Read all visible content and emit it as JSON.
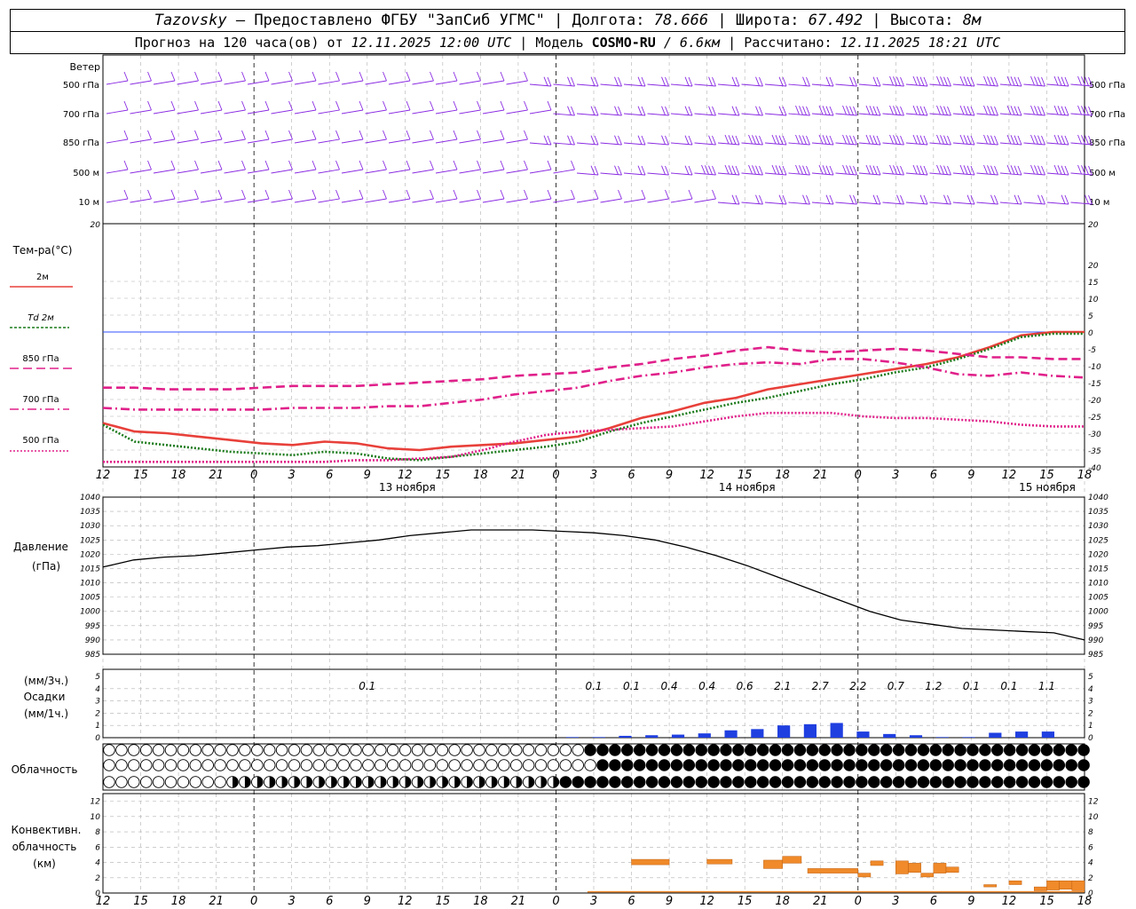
{
  "header": {
    "station": "Tazovsky",
    "provider": "— Предоставлено ФГБУ \"ЗапСиб УГМС\"",
    "lon_label": "Долгота:",
    "lon_value": "78.666",
    "lat_label": "Широта:",
    "lat_value": "67.492",
    "alt_label": "Высота:",
    "alt_value": "8м",
    "forecast_label": "Прогноз на 120 часа(ов) от",
    "forecast_start": "12.11.2025 12:00 UTC",
    "model_label": "Модель",
    "model_name": "COSMO-RU",
    "model_res": "/ 6.6км",
    "calc_label": "Рассчитано:",
    "calc_time": "12.11.2025 18:21 UTC"
  },
  "colors": {
    "wind": "#8a2be2",
    "t2m": "#e8403a",
    "td2m": "#1a7a1a",
    "t850": "#e0208a",
    "t700": "#e0208a",
    "t500": "#e0208a",
    "pressure": "#000000",
    "precip": "#1f3fe0",
    "convective": "#f08a2a",
    "zero_line": "#3050ff",
    "grid": "#b0b0b0"
  },
  "time_axis": {
    "hour_labels": [
      "12",
      "15",
      "18",
      "21",
      "0",
      "3",
      "6",
      "9",
      "12",
      "15",
      "18",
      "21",
      "0",
      "3",
      "6",
      "9",
      "12",
      "15",
      "18",
      "21",
      "0",
      "3",
      "6",
      "9",
      "12",
      "15",
      "18"
    ],
    "day_labels": [
      "13 ноября",
      "14 ноября",
      "15 ноября"
    ]
  },
  "wind_panel": {
    "title": "Ветер",
    "levels": [
      "500 гПа",
      "700 гПа",
      "850 гПа",
      "500 м",
      "10  м"
    ],
    "speed_class": [
      [
        1,
        1,
        1,
        1,
        1,
        1,
        1,
        1,
        1,
        1,
        1,
        1,
        1,
        1,
        1,
        1,
        1,
        1,
        2,
        2,
        2,
        2,
        2,
        2,
        2,
        2,
        2,
        2,
        2,
        2,
        2,
        2,
        2,
        3,
        3,
        3,
        3,
        3,
        3,
        3,
        3,
        3
      ],
      [
        1,
        1,
        1,
        1,
        1,
        1,
        1,
        1,
        1,
        1,
        1,
        1,
        1,
        1,
        1,
        1,
        1,
        1,
        1,
        2,
        2,
        2,
        2,
        2,
        2,
        2,
        2,
        2,
        2,
        3,
        3,
        3,
        3,
        3,
        3,
        3,
        3,
        3,
        3,
        3,
        3,
        3
      ],
      [
        1,
        1,
        1,
        1,
        1,
        1,
        1,
        1,
        1,
        1,
        1,
        1,
        1,
        1,
        1,
        1,
        1,
        1,
        2,
        2,
        2,
        2,
        2,
        2,
        2,
        2,
        3,
        3,
        3,
        3,
        3,
        3,
        3,
        3,
        3,
        3,
        3,
        3,
        3,
        3,
        3,
        3
      ],
      [
        1,
        1,
        1,
        1,
        1,
        1,
        1,
        1,
        1,
        1,
        1,
        1,
        1,
        1,
        1,
        1,
        1,
        1,
        1,
        1,
        2,
        2,
        2,
        2,
        2,
        3,
        3,
        3,
        3,
        3,
        3,
        3,
        3,
        3,
        3,
        3,
        3,
        3,
        3,
        3,
        3,
        3
      ],
      [
        1,
        1,
        1,
        1,
        1,
        1,
        1,
        1,
        1,
        1,
        1,
        1,
        1,
        1,
        1,
        1,
        1,
        1,
        1,
        1,
        1,
        1,
        1,
        1,
        1,
        1,
        2,
        2,
        2,
        2,
        2,
        2,
        2,
        2,
        2,
        2,
        2,
        2,
        2,
        2,
        2,
        2
      ]
    ]
  },
  "temp_panel": {
    "title": "Тем-ра(°C)",
    "legend": [
      "2м",
      "Td  2м",
      "850 гПа",
      "700 гПа",
      "500 гПа"
    ],
    "ticks": [
      "20",
      "15",
      "10",
      "5",
      "0",
      "-5",
      "-10",
      "-15",
      "-20",
      "-25",
      "-30",
      "-35",
      "-40"
    ]
  },
  "pressure_panel": {
    "title": "Давление",
    "unit": "(гПа)",
    "ticks": [
      "1040",
      "1035",
      "1030",
      "1025",
      "1020",
      "1015",
      "1010",
      "1005",
      "1000",
      "995",
      "990",
      "985"
    ]
  },
  "precip_panel": {
    "unit_top": "(мм/3ч.)",
    "title": "Осадки",
    "unit_bottom": "(мм/1ч.)",
    "ticks": [
      "5",
      "4",
      "3",
      "2",
      "1",
      "0"
    ],
    "totals": [
      {
        "hour": 21,
        "label": "0.1"
      },
      {
        "hour": 39,
        "label": "0.1"
      },
      {
        "hour": 42,
        "label": "0.1"
      },
      {
        "hour": 45,
        "label": "0.4"
      },
      {
        "hour": 48,
        "label": "0.4"
      },
      {
        "hour": 51,
        "label": "0.6"
      },
      {
        "hour": 54,
        "label": "2.1"
      },
      {
        "hour": 57,
        "label": "2.7"
      },
      {
        "hour": 60,
        "label": "2.2"
      },
      {
        "hour": 63,
        "label": "0.7"
      },
      {
        "hour": 66,
        "label": "1.2"
      },
      {
        "hour": 69,
        "label": "0.1"
      },
      {
        "hour": 72,
        "label": "0.1"
      },
      {
        "hour": 75,
        "label": "1.1"
      }
    ]
  },
  "cloud_panel": {
    "title": "Облачность"
  },
  "conv_panel": {
    "title_1": "Конвективн.",
    "title_2": "облачность",
    "unit": "(км)",
    "ticks": [
      "12",
      "10",
      "8",
      "6",
      "4",
      "2",
      "0"
    ]
  },
  "chart_data": [
    {
      "type": "line",
      "title": "Тем-ра(°C)",
      "x_unit": "hours from 12.11.2025 12:00 UTC",
      "ylim": [
        -40,
        20
      ],
      "grid": true,
      "x": [
        0,
        3,
        6,
        9,
        12,
        15,
        18,
        21,
        24,
        27,
        30,
        33,
        36,
        39,
        42,
        45,
        48,
        51,
        54,
        57,
        60,
        63,
        66,
        69,
        72,
        75,
        78
      ],
      "series": [
        {
          "name": "2м",
          "style": "solid",
          "values": [
            -27,
            -29.5,
            -30,
            -31,
            -32,
            -33,
            -33.5,
            -32.5,
            -33,
            -34.5,
            -35,
            -34,
            -33.5,
            -33,
            -32,
            -31,
            -28.5,
            -25.5,
            -23.5,
            -21,
            -19.5,
            -17,
            -15.5,
            -14,
            -12.5,
            -11,
            -9.5,
            -7.5,
            -4.5,
            -1,
            0,
            0
          ]
        },
        {
          "name": "Td  2м",
          "style": "dotted",
          "values": [
            -27.5,
            -32.5,
            -33.5,
            -34.5,
            -35.5,
            -36,
            -36.5,
            -35.5,
            -36,
            -37.5,
            -38,
            -37,
            -36,
            -35,
            -34,
            -32.5,
            -29.5,
            -27,
            -25,
            -23,
            -21,
            -19.5,
            -17.5,
            -15.5,
            -14,
            -12,
            -10.5,
            -8,
            -5,
            -1.5,
            -0.5,
            -0.5
          ]
        },
        {
          "name": "850 гПа",
          "style": "dashed",
          "values": [
            -16.5,
            -16.5,
            -17,
            -17,
            -17,
            -16.5,
            -16,
            -16,
            -16,
            -15.5,
            -15,
            -14.5,
            -14,
            -13,
            -12.5,
            -12,
            -10.5,
            -9.5,
            -8,
            -7,
            -5.5,
            -4.5,
            -5.5,
            -6,
            -5.5,
            -5,
            -5.5,
            -6.5,
            -7.5,
            -7.5,
            -8,
            -8
          ]
        },
        {
          "name": "700 гПа",
          "style": "dashdot",
          "values": [
            -22.5,
            -23,
            -23,
            -23,
            -23,
            -23,
            -22.5,
            -22.5,
            -22.5,
            -22,
            -22,
            -21,
            -20,
            -18.5,
            -17.5,
            -16.5,
            -14.5,
            -13,
            -12,
            -10.5,
            -9.5,
            -9,
            -9.5,
            -8,
            -8,
            -9,
            -10.5,
            -12.5,
            -13,
            -12,
            -13,
            -13.5
          ]
        },
        {
          "name": "500 гПа",
          "style": "dotted",
          "values": [
            -38.5,
            -38.5,
            -38.5,
            -38.5,
            -38.5,
            -38.5,
            -38.5,
            -38.5,
            -38,
            -38,
            -37.5,
            -37,
            -35,
            -32.5,
            -30.5,
            -29.5,
            -29,
            -28.5,
            -28,
            -26.5,
            -25,
            -24,
            -24,
            -24,
            -25,
            -25.5,
            -25.5,
            -26,
            -26.5,
            -27.5,
            -28,
            -28
          ]
        }
      ]
    },
    {
      "type": "line",
      "title": "Давление",
      "ylabel": "(гПа)",
      "ylim": [
        985,
        1040
      ],
      "grid": true,
      "x": [
        0,
        3,
        6,
        9,
        12,
        15,
        18,
        21,
        24,
        27,
        30,
        33,
        36,
        39,
        42,
        45,
        48,
        51,
        54,
        57,
        60,
        63,
        66,
        69,
        72,
        75,
        78
      ],
      "series": [
        {
          "name": "",
          "values": [
            1015.5,
            1018,
            1019,
            1019.5,
            1020.5,
            1021.5,
            1022.5,
            1023,
            1024,
            1025,
            1026.5,
            1027.5,
            1028.5,
            1028.5,
            1028.5,
            1028,
            1027.5,
            1026.5,
            1025,
            1022.5,
            1019.5,
            1016,
            1012,
            1008,
            1004,
            1000,
            997,
            995.5,
            994,
            993.5,
            993,
            992.5,
            990
          ]
        }
      ]
    },
    {
      "type": "bar",
      "title": "Осадки",
      "ylabel": "(мм/1ч.)",
      "ylim": [
        0,
        5
      ],
      "x_unit": "hours from 12.11.2025 12:00 UTC",
      "x": [
        39,
        42,
        45,
        48,
        51,
        54,
        57,
        60,
        63,
        66,
        69,
        72,
        75,
        76.5,
        78
      ],
      "values": [
        0.05,
        0.05,
        0.15,
        0.2,
        0.25,
        0.35,
        0.6,
        0.7,
        1.0,
        1.1,
        1.2,
        0.5,
        0.3,
        0.2,
        0.05,
        0.05,
        0.4,
        0.5,
        0.5
      ]
    },
    {
      "type": "bar",
      "title": "Конвективн. облачность",
      "ylabel": "(км)",
      "ylim": [
        0,
        13
      ],
      "x_unit": "hours from 12.11.2025 12:00 UTC",
      "segments": [
        {
          "from": 42,
          "to": 45,
          "bottom": 3.7,
          "top": 4.4
        },
        {
          "from": 48,
          "to": 50,
          "bottom": 3.8,
          "top": 4.4
        },
        {
          "from": 52.5,
          "to": 54,
          "bottom": 3.2,
          "top": 4.3
        },
        {
          "from": 54,
          "to": 55.5,
          "bottom": 3.9,
          "top": 4.8
        },
        {
          "from": 56,
          "to": 60,
          "bottom": 2.6,
          "top": 3.2
        },
        {
          "from": 60,
          "to": 61,
          "bottom": 2.1,
          "top": 2.6
        },
        {
          "from": 61,
          "to": 62,
          "bottom": 3.6,
          "top": 4.2
        },
        {
          "from": 63,
          "to": 64,
          "bottom": 2.5,
          "top": 4.2
        },
        {
          "from": 64,
          "to": 65,
          "bottom": 2.7,
          "top": 3.9
        },
        {
          "from": 65,
          "to": 66,
          "bottom": 2.1,
          "top": 2.6
        },
        {
          "from": 66,
          "to": 67,
          "bottom": 2.6,
          "top": 3.9
        },
        {
          "from": 67,
          "to": 68,
          "bottom": 2.7,
          "top": 3.4
        },
        {
          "from": 70,
          "to": 71,
          "bottom": 0.8,
          "top": 1.1
        },
        {
          "from": 72,
          "to": 73,
          "bottom": 1.1,
          "top": 1.6
        },
        {
          "from": 74,
          "to": 75,
          "bottom": 0.3,
          "top": 0.8
        },
        {
          "from": 75,
          "to": 76,
          "bottom": 0.4,
          "top": 1.6
        },
        {
          "from": 76,
          "to": 77,
          "bottom": 0.5,
          "top": 1.6
        },
        {
          "from": 77,
          "to": 78,
          "bottom": 0.3,
          "top": 1.6
        }
      ]
    }
  ]
}
